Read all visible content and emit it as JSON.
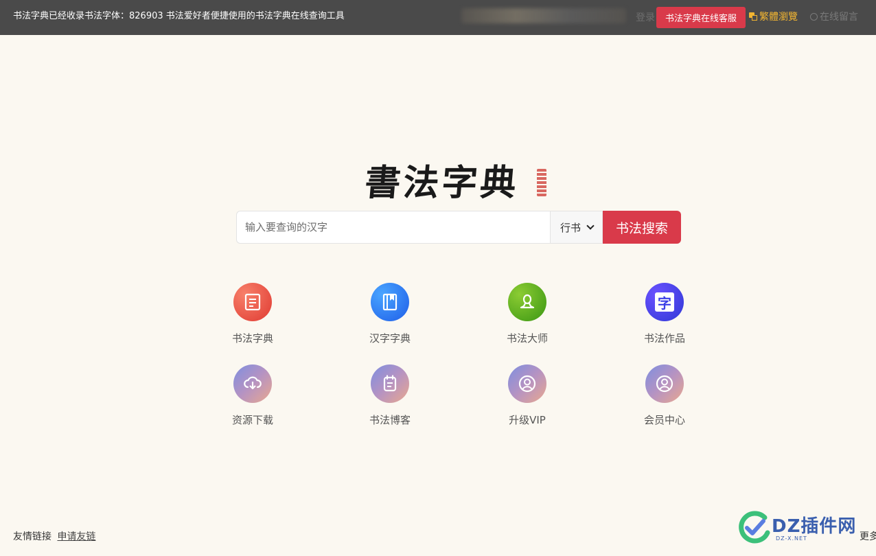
{
  "topbar": {
    "notice": "书法字典已经收录书法字体：826903 书法爱好者便捷使用的书法字典在线查询工具",
    "login_partial": "登录",
    "service_button": "书法字典在线客服",
    "traditional_link": "繁體瀏覽",
    "message_link": "在线留言"
  },
  "logo": {
    "text": "書法字典"
  },
  "search": {
    "placeholder": "输入要查询的汉字",
    "value": "",
    "font_selected": "行书",
    "button": "书法搜索"
  },
  "nav": [
    {
      "label": "书法字典",
      "icon": "document-icon",
      "color": "#e6463a"
    },
    {
      "label": "汉字字典",
      "icon": "book-icon",
      "color": "#2a73f0"
    },
    {
      "label": "书法大师",
      "icon": "person-icon",
      "color": "#5bab1e"
    },
    {
      "label": "书法作品",
      "icon": "character-icon",
      "color": "#3b3fe6",
      "glyph": "字"
    },
    {
      "label": "资源下载",
      "icon": "cloud-download-icon",
      "color": "#a391cf"
    },
    {
      "label": "书法博客",
      "icon": "notepad-icon",
      "color": "#a391cf"
    },
    {
      "label": "升级VIP",
      "icon": "user-circle-icon",
      "color": "#a391cf"
    },
    {
      "label": "会员中心",
      "icon": "user-circle-icon",
      "color": "#a391cf"
    }
  ],
  "footer": {
    "links_label": "友情链接",
    "apply_link": "申请友链",
    "more_partial": "更多"
  },
  "watermark": {
    "text": "DZ插件网",
    "sub": "DZ-X.NET"
  }
}
